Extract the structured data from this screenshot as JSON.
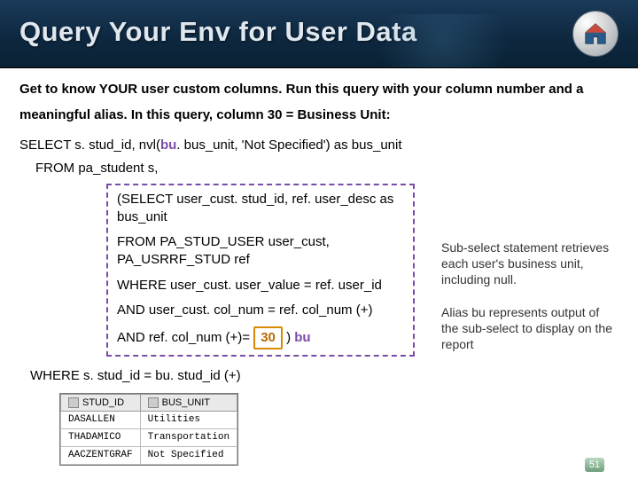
{
  "header": {
    "title": "Query Your Env for User Data",
    "home_label": "home"
  },
  "intro": "Get to know YOUR user custom columns. Run this query with your column number and a meaningful alias. In this query, column 30 = Business Unit:",
  "query": {
    "select": "SELECT s. stud_id, nvl(",
    "select_bu": "bu",
    "select_tail": ". bus_unit, 'Not Specified') as bus_unit",
    "from1": "FROM pa_student s,",
    "sub": {
      "l1": "(SELECT user_cust. stud_id, ref. user_desc as bus_unit",
      "l2": "FROM PA_STUD_USER user_cust, PA_USRRF_STUD ref",
      "l3": "WHERE user_cust. user_value = ref. user_id",
      "l4": "AND user_cust. col_num = ref. col_num (+)",
      "l5_pre": " AND ref. col_num (+)= ",
      "l5_num": "30",
      "l5_post": " ) ",
      "l5_alias": "bu"
    },
    "where_outer": "WHERE s. stud_id = bu. stud_id  (+)"
  },
  "annotations": {
    "a1": "Sub-select statement retrieves each user's business unit, including null.",
    "a2": "Alias bu represents output of the sub-select to display on the report"
  },
  "table": {
    "headers": [
      "STUD_ID",
      "BUS_UNIT"
    ],
    "rows": [
      [
        "DASALLEN",
        "Utilities"
      ],
      [
        "THADAMICO",
        "Transportation"
      ],
      [
        "AACZENTGRAF",
        "Not Specified"
      ]
    ]
  },
  "page_number": "51"
}
